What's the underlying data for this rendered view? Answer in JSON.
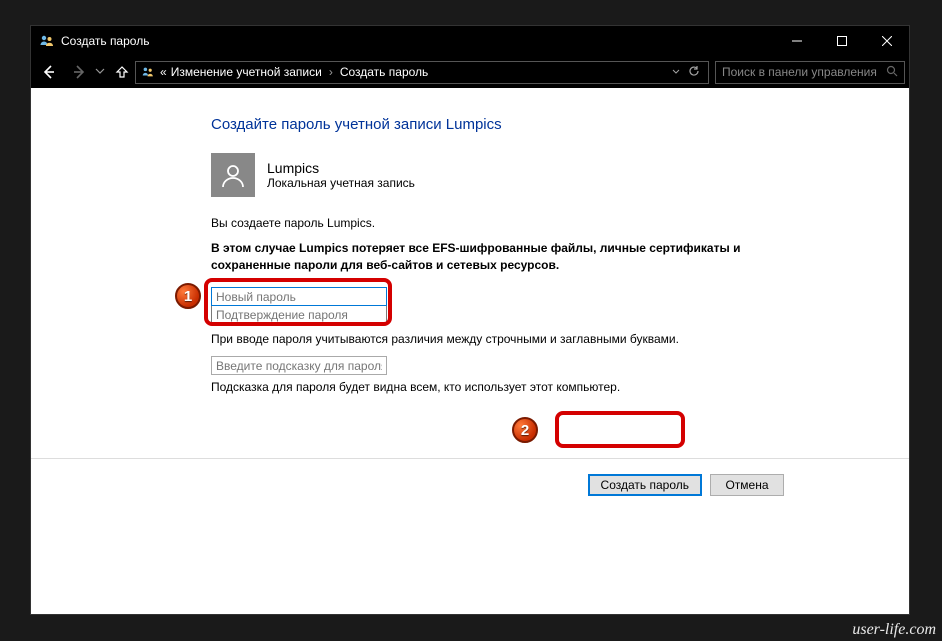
{
  "window": {
    "title": "Создать пароль"
  },
  "nav": {
    "breadcrumb1": "Изменение учетной записи",
    "breadcrumb2": "Создать пароль",
    "search_placeholder": "Поиск в панели управления"
  },
  "page": {
    "heading": "Создайте пароль учетной записи Lumpics",
    "user_name": "Lumpics",
    "user_type": "Локальная учетная запись",
    "creating_for": "Вы создаете пароль Lumpics.",
    "warning": "В этом случае Lumpics потеряет все EFS-шифрованные файлы, личные сертификаты и сохраненные пароли для веб-сайтов и сетевых ресурсов.",
    "new_pw_placeholder": "Новый пароль",
    "confirm_pw_placeholder": "Подтверждение пароля",
    "case_note": "При вводе пароля учитываются различия между строчными и заглавными буквами.",
    "hint_placeholder": "Введите подсказку для пароля",
    "hint_note": "Подсказка для пароля будет видна всем, кто использует этот компьютер.",
    "create_btn": "Создать пароль",
    "cancel_btn": "Отмена"
  },
  "badges": {
    "b1": "1",
    "b2": "2"
  },
  "watermark": "user-life.com"
}
